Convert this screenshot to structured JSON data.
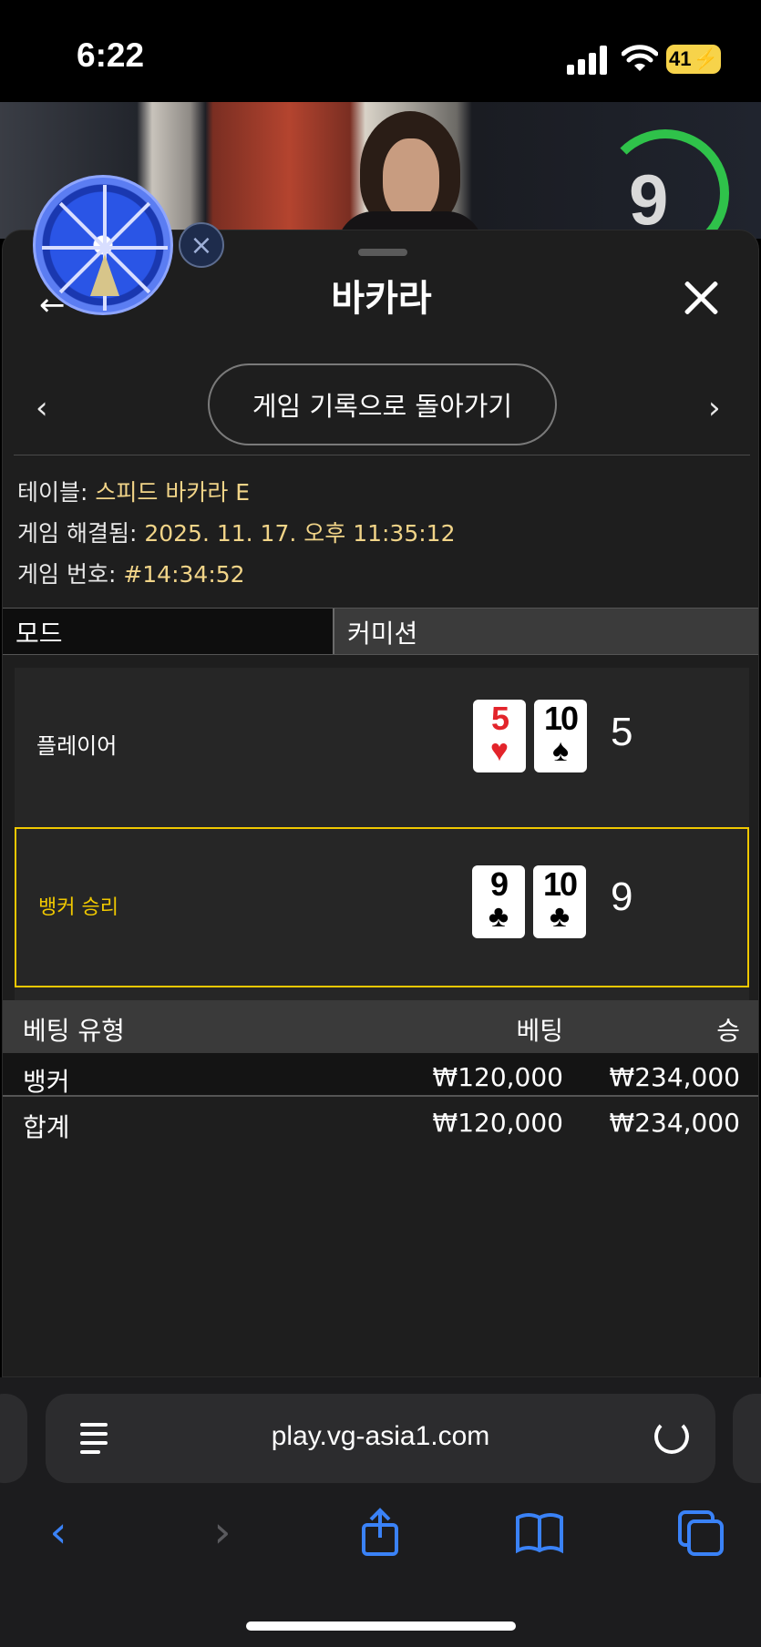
{
  "status": {
    "time": "6:22",
    "battery": "41"
  },
  "video": {
    "timer": "9"
  },
  "panel": {
    "title": "바카라",
    "history_button": "게임 기록으로 돌아가기",
    "table_label": "테이블: ",
    "table_value": "스피드 바카라 E",
    "resolved_label": "게임 해결됨: ",
    "resolved_value": "2025. 11. 17. 오후 11:35:12",
    "number_label": "게임 번호: ",
    "number_value": "#14:34:52",
    "tab_mode": "모드",
    "tab_commission": "커미션"
  },
  "result": {
    "player": {
      "label": "플레이어",
      "score": "5",
      "cards": [
        {
          "rank": "5",
          "suit": "♥",
          "color": "#e3242b"
        },
        {
          "rank": "10",
          "suit": "♠",
          "color": "#000000"
        }
      ]
    },
    "banker": {
      "label": "뱅커 승리",
      "score": "9",
      "cards": [
        {
          "rank": "9",
          "suit": "♣",
          "color": "#000000"
        },
        {
          "rank": "10",
          "suit": "♣",
          "color": "#000000"
        }
      ]
    },
    "highlight_color": "#f0c800"
  },
  "bets": {
    "headers": {
      "type": "베팅 유형",
      "bet": "베팅",
      "win": "승"
    },
    "rows": [
      {
        "type": "뱅커",
        "bet": "₩120,000",
        "win": "₩234,000"
      },
      {
        "type": "합계",
        "bet": "₩120,000",
        "win": "₩234,000"
      }
    ]
  },
  "browser": {
    "url": "play.vg-asia1.com",
    "accent": "#3a82f7"
  }
}
